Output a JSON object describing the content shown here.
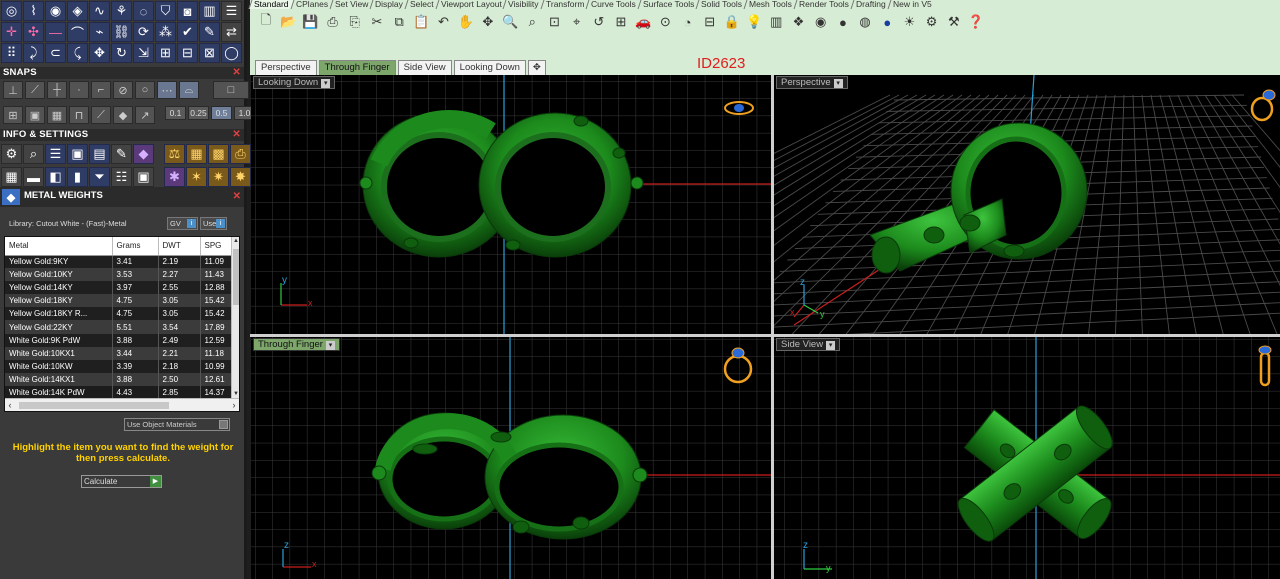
{
  "left_panel": {
    "sections": {
      "snaps": "SNAPS",
      "info_settings": "INFO & SETTINGS",
      "metal_weights": "METAL WEIGHTS"
    },
    "tolerances": [
      "0.1",
      "0.25",
      "0.5",
      "1.0"
    ],
    "library_label": "Library: Cutout White - (Fast)-Metal",
    "gv_label": "GV",
    "user_label": "User",
    "table": {
      "headers": [
        "Metal",
        "Grams",
        "DWT",
        "SPG"
      ],
      "rows": [
        [
          "Yellow Gold:9KY",
          "3.41",
          "2.19",
          "11.09"
        ],
        [
          "Yellow Gold:10KY",
          "3.53",
          "2.27",
          "11.43"
        ],
        [
          "Yellow Gold:14KY",
          "3.97",
          "2.55",
          "12.88"
        ],
        [
          "Yellow Gold:18KY",
          "4.75",
          "3.05",
          "15.42"
        ],
        [
          "Yellow Gold:18KY R...",
          "4.75",
          "3.05",
          "15.42"
        ],
        [
          "Yellow Gold:22KY",
          "5.51",
          "3.54",
          "17.89"
        ],
        [
          "White Gold:9K PdW",
          "3.88",
          "2.49",
          "12.59"
        ],
        [
          "White Gold:10KX1",
          "3.44",
          "2.21",
          "11.18"
        ],
        [
          "White Gold:10KW",
          "3.39",
          "2.18",
          "10.99"
        ],
        [
          "White Gold:14KX1",
          "3.88",
          "2.50",
          "12.61"
        ],
        [
          "White Gold:14K PdW",
          "4.43",
          "2.85",
          "14.37"
        ]
      ]
    },
    "use_object_materials": "Use Object Materials",
    "hint": "Highlight the item you want to find the weight for then press calculate.",
    "calculate_label": "Calculate"
  },
  "toolbar": {
    "tabs": [
      "Standard",
      "CPlanes",
      "Set View",
      "Display",
      "Select",
      "Viewport Layout",
      "Visibility",
      "Transform",
      "Curve Tools",
      "Surface Tools",
      "Solid Tools",
      "Mesh Tools",
      "Render Tools",
      "Drafting",
      "New in V5"
    ],
    "active_tab": "Standard"
  },
  "viewport_tabs": [
    "Perspective",
    "Through Finger",
    "Side View",
    "Looking Down"
  ],
  "active_viewport_tab": "Through Finger",
  "id_label": "ID2623",
  "viewports": {
    "top_left": {
      "label": "Looking Down",
      "axes": [
        "y",
        "x"
      ]
    },
    "top_right": {
      "label": "Perspective",
      "axes": [
        "z",
        "x",
        "y"
      ]
    },
    "bottom_left": {
      "label": "Through Finger",
      "axes": [
        "z",
        "x"
      ]
    },
    "bottom_right": {
      "label": "Side View",
      "axes": [
        "z",
        "y"
      ]
    }
  },
  "colors": {
    "ring_green": "#1f8a1f",
    "ring_dark": "#0c4a0c",
    "grid": "#3c3c3c",
    "axis_red": "#c81e1e",
    "axis_blue": "#2aa0d8",
    "toolbar_bg": "#d7ecd4",
    "active_tab": "#7da66b",
    "id_red": "#e11d1d",
    "hint_yellow": "#ffd200"
  }
}
